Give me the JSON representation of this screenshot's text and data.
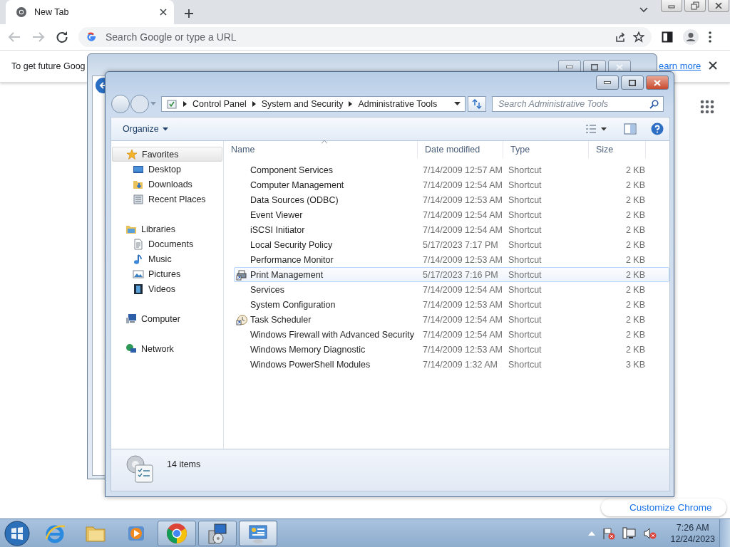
{
  "browser": {
    "tab": {
      "title": "New Tab",
      "selected": true
    },
    "omnibox": {
      "placeholder": "Search Google or type a URL"
    },
    "infobar": {
      "text": "To get future Goog",
      "link": "earn more"
    },
    "customize_button": "Customize Chrome"
  },
  "explorer": {
    "breadcrumb": [
      "Control Panel",
      "System and Security",
      "Administrative Tools"
    ],
    "search": {
      "placeholder": "Search Administrative Tools"
    },
    "organize": "Organize",
    "nav": [
      {
        "label": "Favorites",
        "kind": "star",
        "selected": true,
        "children": [
          {
            "label": "Desktop",
            "kind": "desktop",
            "selected": false
          },
          {
            "label": "Downloads",
            "kind": "downloads",
            "selected": false
          },
          {
            "label": "Recent Places",
            "kind": "recent",
            "selected": false
          }
        ]
      },
      {
        "label": "Libraries",
        "kind": "library",
        "selected": false,
        "children": [
          {
            "label": "Documents",
            "kind": "documents",
            "selected": false
          },
          {
            "label": "Music",
            "kind": "music",
            "selected": false
          },
          {
            "label": "Pictures",
            "kind": "pictures",
            "selected": false
          },
          {
            "label": "Videos",
            "kind": "videos",
            "selected": false
          }
        ]
      },
      {
        "label": "Computer",
        "kind": "computer",
        "selected": false
      },
      {
        "label": "Network",
        "kind": "network",
        "selected": false
      }
    ],
    "columns": [
      "Name",
      "Date modified",
      "Type",
      "Size"
    ],
    "rows": [
      {
        "name": "Component Services",
        "date": "7/14/2009 12:57 AM",
        "type": "Shortcut",
        "size": "2 KB",
        "hovered": false
      },
      {
        "name": "Computer Management",
        "date": "7/14/2009 12:54 AM",
        "type": "Shortcut",
        "size": "2 KB",
        "hovered": false
      },
      {
        "name": "Data Sources (ODBC)",
        "date": "7/14/2009 12:53 AM",
        "type": "Shortcut",
        "size": "2 KB",
        "hovered": false
      },
      {
        "name": "Event Viewer",
        "date": "7/14/2009 12:54 AM",
        "type": "Shortcut",
        "size": "2 KB",
        "hovered": false
      },
      {
        "name": "iSCSI Initiator",
        "date": "7/14/2009 12:54 AM",
        "type": "Shortcut",
        "size": "2 KB",
        "hovered": false
      },
      {
        "name": "Local Security Policy",
        "date": "5/17/2023 7:17 PM",
        "type": "Shortcut",
        "size": "2 KB",
        "hovered": false
      },
      {
        "name": "Performance Monitor",
        "date": "7/14/2009 12:53 AM",
        "type": "Shortcut",
        "size": "2 KB",
        "hovered": false
      },
      {
        "name": "Print Management",
        "date": "5/17/2023 7:16 PM",
        "type": "Shortcut",
        "size": "2 KB",
        "hovered": true,
        "kind": "printer"
      },
      {
        "name": "Services",
        "date": "7/14/2009 12:54 AM",
        "type": "Shortcut",
        "size": "2 KB",
        "hovered": false
      },
      {
        "name": "System Configuration",
        "date": "7/14/2009 12:53 AM",
        "type": "Shortcut",
        "size": "2 KB",
        "hovered": false
      },
      {
        "name": "Task Scheduler",
        "date": "7/14/2009 12:54 AM",
        "type": "Shortcut",
        "size": "2 KB",
        "hovered": false,
        "kind": "clock"
      },
      {
        "name": "Windows Firewall with Advanced Security",
        "date": "7/14/2009 12:54 AM",
        "type": "Shortcut",
        "size": "2 KB",
        "hovered": false
      },
      {
        "name": "Windows Memory Diagnostic",
        "date": "7/14/2009 12:53 AM",
        "type": "Shortcut",
        "size": "2 KB",
        "hovered": false
      },
      {
        "name": "Windows PowerShell Modules",
        "date": "7/14/2009 1:32 AM",
        "type": "Shortcut",
        "size": "3 KB",
        "hovered": false
      }
    ],
    "status": "14 items"
  },
  "taskbar": {
    "apps": [
      {
        "kind": "ie",
        "running": false,
        "selected": false
      },
      {
        "kind": "folder",
        "running": false,
        "selected": false
      },
      {
        "kind": "media",
        "running": false,
        "selected": false
      },
      {
        "kind": "chrome",
        "running": true,
        "selected": false
      },
      {
        "kind": "installer",
        "running": true,
        "selected": false
      },
      {
        "kind": "control-panel",
        "running": true,
        "selected": true
      }
    ],
    "clock": {
      "time": "7:26 AM",
      "date": "12/24/2023"
    }
  }
}
